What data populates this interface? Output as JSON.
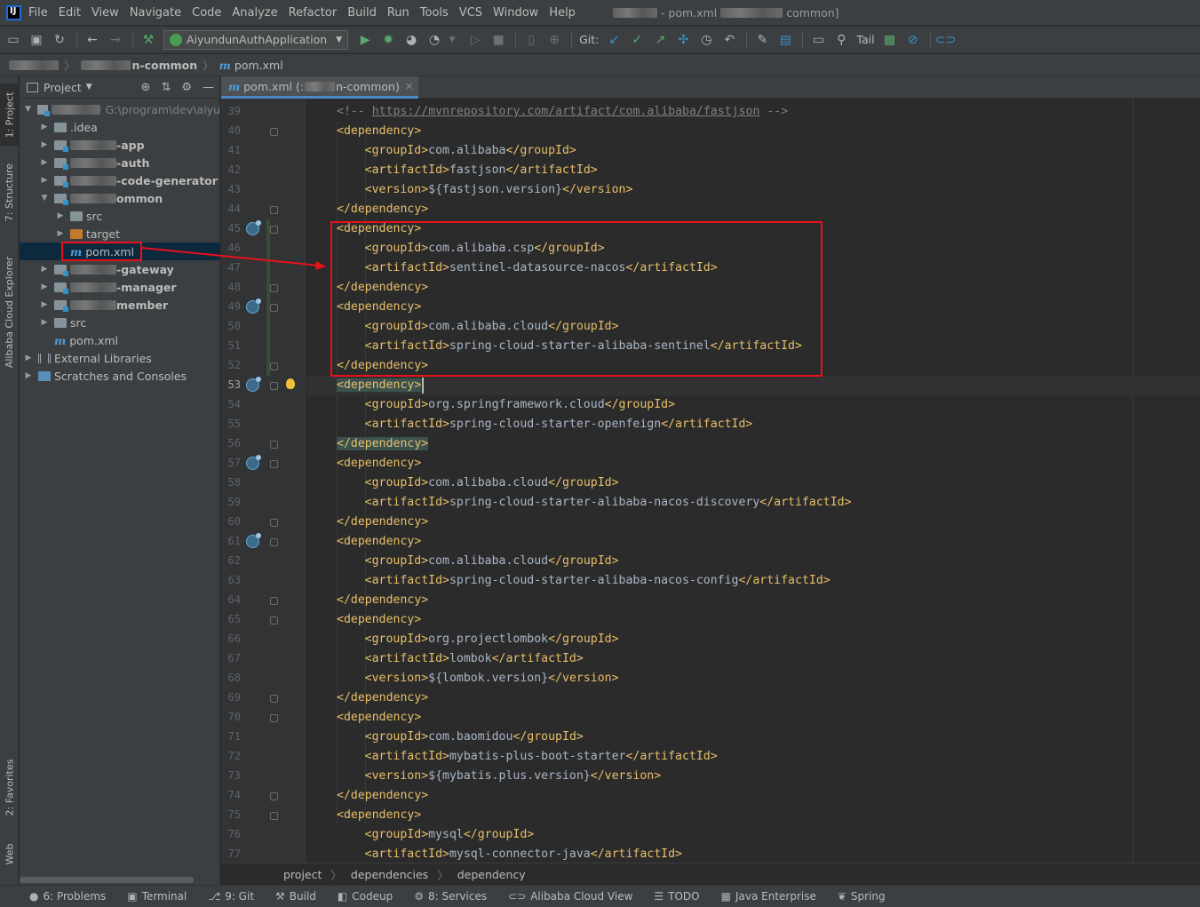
{
  "menubar": {
    "items": [
      "File",
      "Edit",
      "View",
      "Navigate",
      "Code",
      "Analyze",
      "Refactor",
      "Build",
      "Run",
      "Tools",
      "VCS",
      "Window",
      "Help"
    ],
    "title_file": "- pom.xml",
    "title_module": "common]"
  },
  "toolbar": {
    "run_config": "AiyundunAuthApplication",
    "git_label": "Git:",
    "tail_label": "Tail"
  },
  "navbar": {
    "crumb_module": "n-common",
    "crumb_file": "pom.xml"
  },
  "left_stripe": {
    "project_tab": "1: Project",
    "structure_tab": "7: Structure",
    "cloud_tab": "Alibaba Cloud Explorer",
    "favorites_tab": "2: Favorites",
    "web_tab": "Web"
  },
  "project_panel": {
    "title": "Project",
    "root_path": "G:\\program\\dev\\aiyu",
    "items": [
      {
        "label": ".idea",
        "indent": 1,
        "arrow": "right",
        "icon": "folder"
      },
      {
        "label": "-app",
        "indent": 1,
        "arrow": "right",
        "icon": "module",
        "bold": true
      },
      {
        "label": "-auth",
        "indent": 1,
        "arrow": "right",
        "icon": "module",
        "bold": true
      },
      {
        "label": "-code-generator",
        "indent": 1,
        "arrow": "right",
        "icon": "module",
        "bold": true
      },
      {
        "label": "ommon",
        "indent": 1,
        "arrow": "down",
        "icon": "module",
        "bold": true
      },
      {
        "label": "src",
        "indent": 2,
        "arrow": "right",
        "icon": "folder"
      },
      {
        "label": "target",
        "indent": 2,
        "arrow": "right",
        "icon": "folder-orange"
      },
      {
        "label": "pom.xml",
        "indent": 2,
        "arrow": "",
        "icon": "maven",
        "selected": true
      },
      {
        "label": "-gateway",
        "indent": 1,
        "arrow": "right",
        "icon": "module",
        "bold": true
      },
      {
        "label": "-manager",
        "indent": 1,
        "arrow": "right",
        "icon": "module",
        "bold": true
      },
      {
        "label": "member",
        "indent": 1,
        "arrow": "right",
        "icon": "module",
        "bold": true
      },
      {
        "label": "src",
        "indent": 1,
        "arrow": "right",
        "icon": "folder"
      },
      {
        "label": "pom.xml",
        "indent": 1,
        "arrow": "",
        "icon": "maven"
      },
      {
        "label": "External Libraries",
        "indent": 0,
        "arrow": "right",
        "icon": "library"
      },
      {
        "label": "Scratches and Consoles",
        "indent": 0,
        "arrow": "right",
        "icon": "scratch"
      }
    ]
  },
  "editor": {
    "tab_label": "pom.xml (:",
    "tab_label_suffix": "n-common)",
    "current_line": 53,
    "lines": [
      {
        "n": 39,
        "indent": 1,
        "comment": "<!-- ",
        "link": "https://mvnrepository.com/artifact/com.alibaba/fastjson",
        "comment_end": " -->"
      },
      {
        "n": 40,
        "indent": 1,
        "open": "dependency"
      },
      {
        "n": 41,
        "indent": 2,
        "tag": "groupId",
        "text": "com.alibaba"
      },
      {
        "n": 42,
        "indent": 2,
        "tag": "artifactId",
        "text": "fastjson"
      },
      {
        "n": 43,
        "indent": 2,
        "tag": "version",
        "text": "${fastjson.version}"
      },
      {
        "n": 44,
        "indent": 1,
        "close": "dependency"
      },
      {
        "n": 45,
        "indent": 1,
        "open": "dependency"
      },
      {
        "n": 46,
        "indent": 2,
        "tag": "groupId",
        "text": "com.alibaba.csp"
      },
      {
        "n": 47,
        "indent": 2,
        "tag": "artifactId",
        "text": "sentinel-datasource-nacos"
      },
      {
        "n": 48,
        "indent": 1,
        "close": "dependency"
      },
      {
        "n": 49,
        "indent": 1,
        "open": "dependency"
      },
      {
        "n": 50,
        "indent": 2,
        "tag": "groupId",
        "text": "com.alibaba.cloud"
      },
      {
        "n": 51,
        "indent": 2,
        "tag": "artifactId",
        "text": "spring-cloud-starter-alibaba-sentinel"
      },
      {
        "n": 52,
        "indent": 1,
        "close": "dependency"
      },
      {
        "n": 53,
        "indent": 1,
        "open": "dependency",
        "hl": true
      },
      {
        "n": 54,
        "indent": 2,
        "tag": "groupId",
        "text": "org.springframework.cloud"
      },
      {
        "n": 55,
        "indent": 2,
        "tag": "artifactId",
        "text": "spring-cloud-starter-openfeign"
      },
      {
        "n": 56,
        "indent": 1,
        "close": "dependency",
        "hl": true
      },
      {
        "n": 57,
        "indent": 1,
        "open": "dependency"
      },
      {
        "n": 58,
        "indent": 2,
        "tag": "groupId",
        "text": "com.alibaba.cloud"
      },
      {
        "n": 59,
        "indent": 2,
        "tag": "artifactId",
        "text": "spring-cloud-starter-alibaba-nacos-discovery"
      },
      {
        "n": 60,
        "indent": 1,
        "close": "dependency"
      },
      {
        "n": 61,
        "indent": 1,
        "open": "dependency"
      },
      {
        "n": 62,
        "indent": 2,
        "tag": "groupId",
        "text": "com.alibaba.cloud"
      },
      {
        "n": 63,
        "indent": 2,
        "tag": "artifactId",
        "text": "spring-cloud-starter-alibaba-nacos-config"
      },
      {
        "n": 64,
        "indent": 1,
        "close": "dependency"
      },
      {
        "n": 65,
        "indent": 1,
        "open": "dependency"
      },
      {
        "n": 66,
        "indent": 2,
        "tag": "groupId",
        "text": "org.projectlombok"
      },
      {
        "n": 67,
        "indent": 2,
        "tag": "artifactId",
        "text": "lombok"
      },
      {
        "n": 68,
        "indent": 2,
        "tag": "version",
        "text": "${lombok.version}"
      },
      {
        "n": 69,
        "indent": 1,
        "close": "dependency"
      },
      {
        "n": 70,
        "indent": 1,
        "open": "dependency"
      },
      {
        "n": 71,
        "indent": 2,
        "tag": "groupId",
        "text": "com.baomidou"
      },
      {
        "n": 72,
        "indent": 2,
        "tag": "artifactId",
        "text": "mybatis-plus-boot-starter"
      },
      {
        "n": 73,
        "indent": 2,
        "tag": "version",
        "text": "${mybatis.plus.version}"
      },
      {
        "n": 74,
        "indent": 1,
        "close": "dependency"
      },
      {
        "n": 75,
        "indent": 1,
        "open": "dependency"
      },
      {
        "n": 76,
        "indent": 2,
        "tag": "groupId",
        "text": "mysql"
      },
      {
        "n": 77,
        "indent": 2,
        "tag": "artifactId",
        "text": "mysql-connector-java"
      }
    ],
    "library_marker_lines": [
      45,
      49,
      53,
      57,
      61
    ]
  },
  "editor_breadcrumb": [
    "project",
    "dependencies",
    "dependency"
  ],
  "bottom_bar": {
    "items": [
      {
        "icon": "problems-icon",
        "glyph": "●",
        "label": "6: Problems"
      },
      {
        "icon": "terminal-icon",
        "glyph": "▣",
        "label": "Terminal"
      },
      {
        "icon": "git-icon",
        "glyph": "⎇",
        "label": "9: Git"
      },
      {
        "icon": "build-icon",
        "glyph": "⚒",
        "label": "Build"
      },
      {
        "icon": "codeup-icon",
        "glyph": "◧",
        "label": "Codeup"
      },
      {
        "icon": "services-icon",
        "glyph": "⚙",
        "label": "8: Services"
      },
      {
        "icon": "alibaba-cloud-icon",
        "glyph": "⊂⊃",
        "label": "Alibaba Cloud View"
      },
      {
        "icon": "todo-icon",
        "glyph": "☰",
        "label": "TODO"
      },
      {
        "icon": "java-enterprise-icon",
        "glyph": "▦",
        "label": "Java Enterprise"
      },
      {
        "icon": "spring-icon",
        "glyph": "❦",
        "label": "Spring"
      }
    ]
  },
  "colors": {
    "highlight_red": "#e8111a",
    "tag_yellow": "#e8bf6a",
    "text": "#a9b7c6",
    "background": "#2b2b2b"
  }
}
